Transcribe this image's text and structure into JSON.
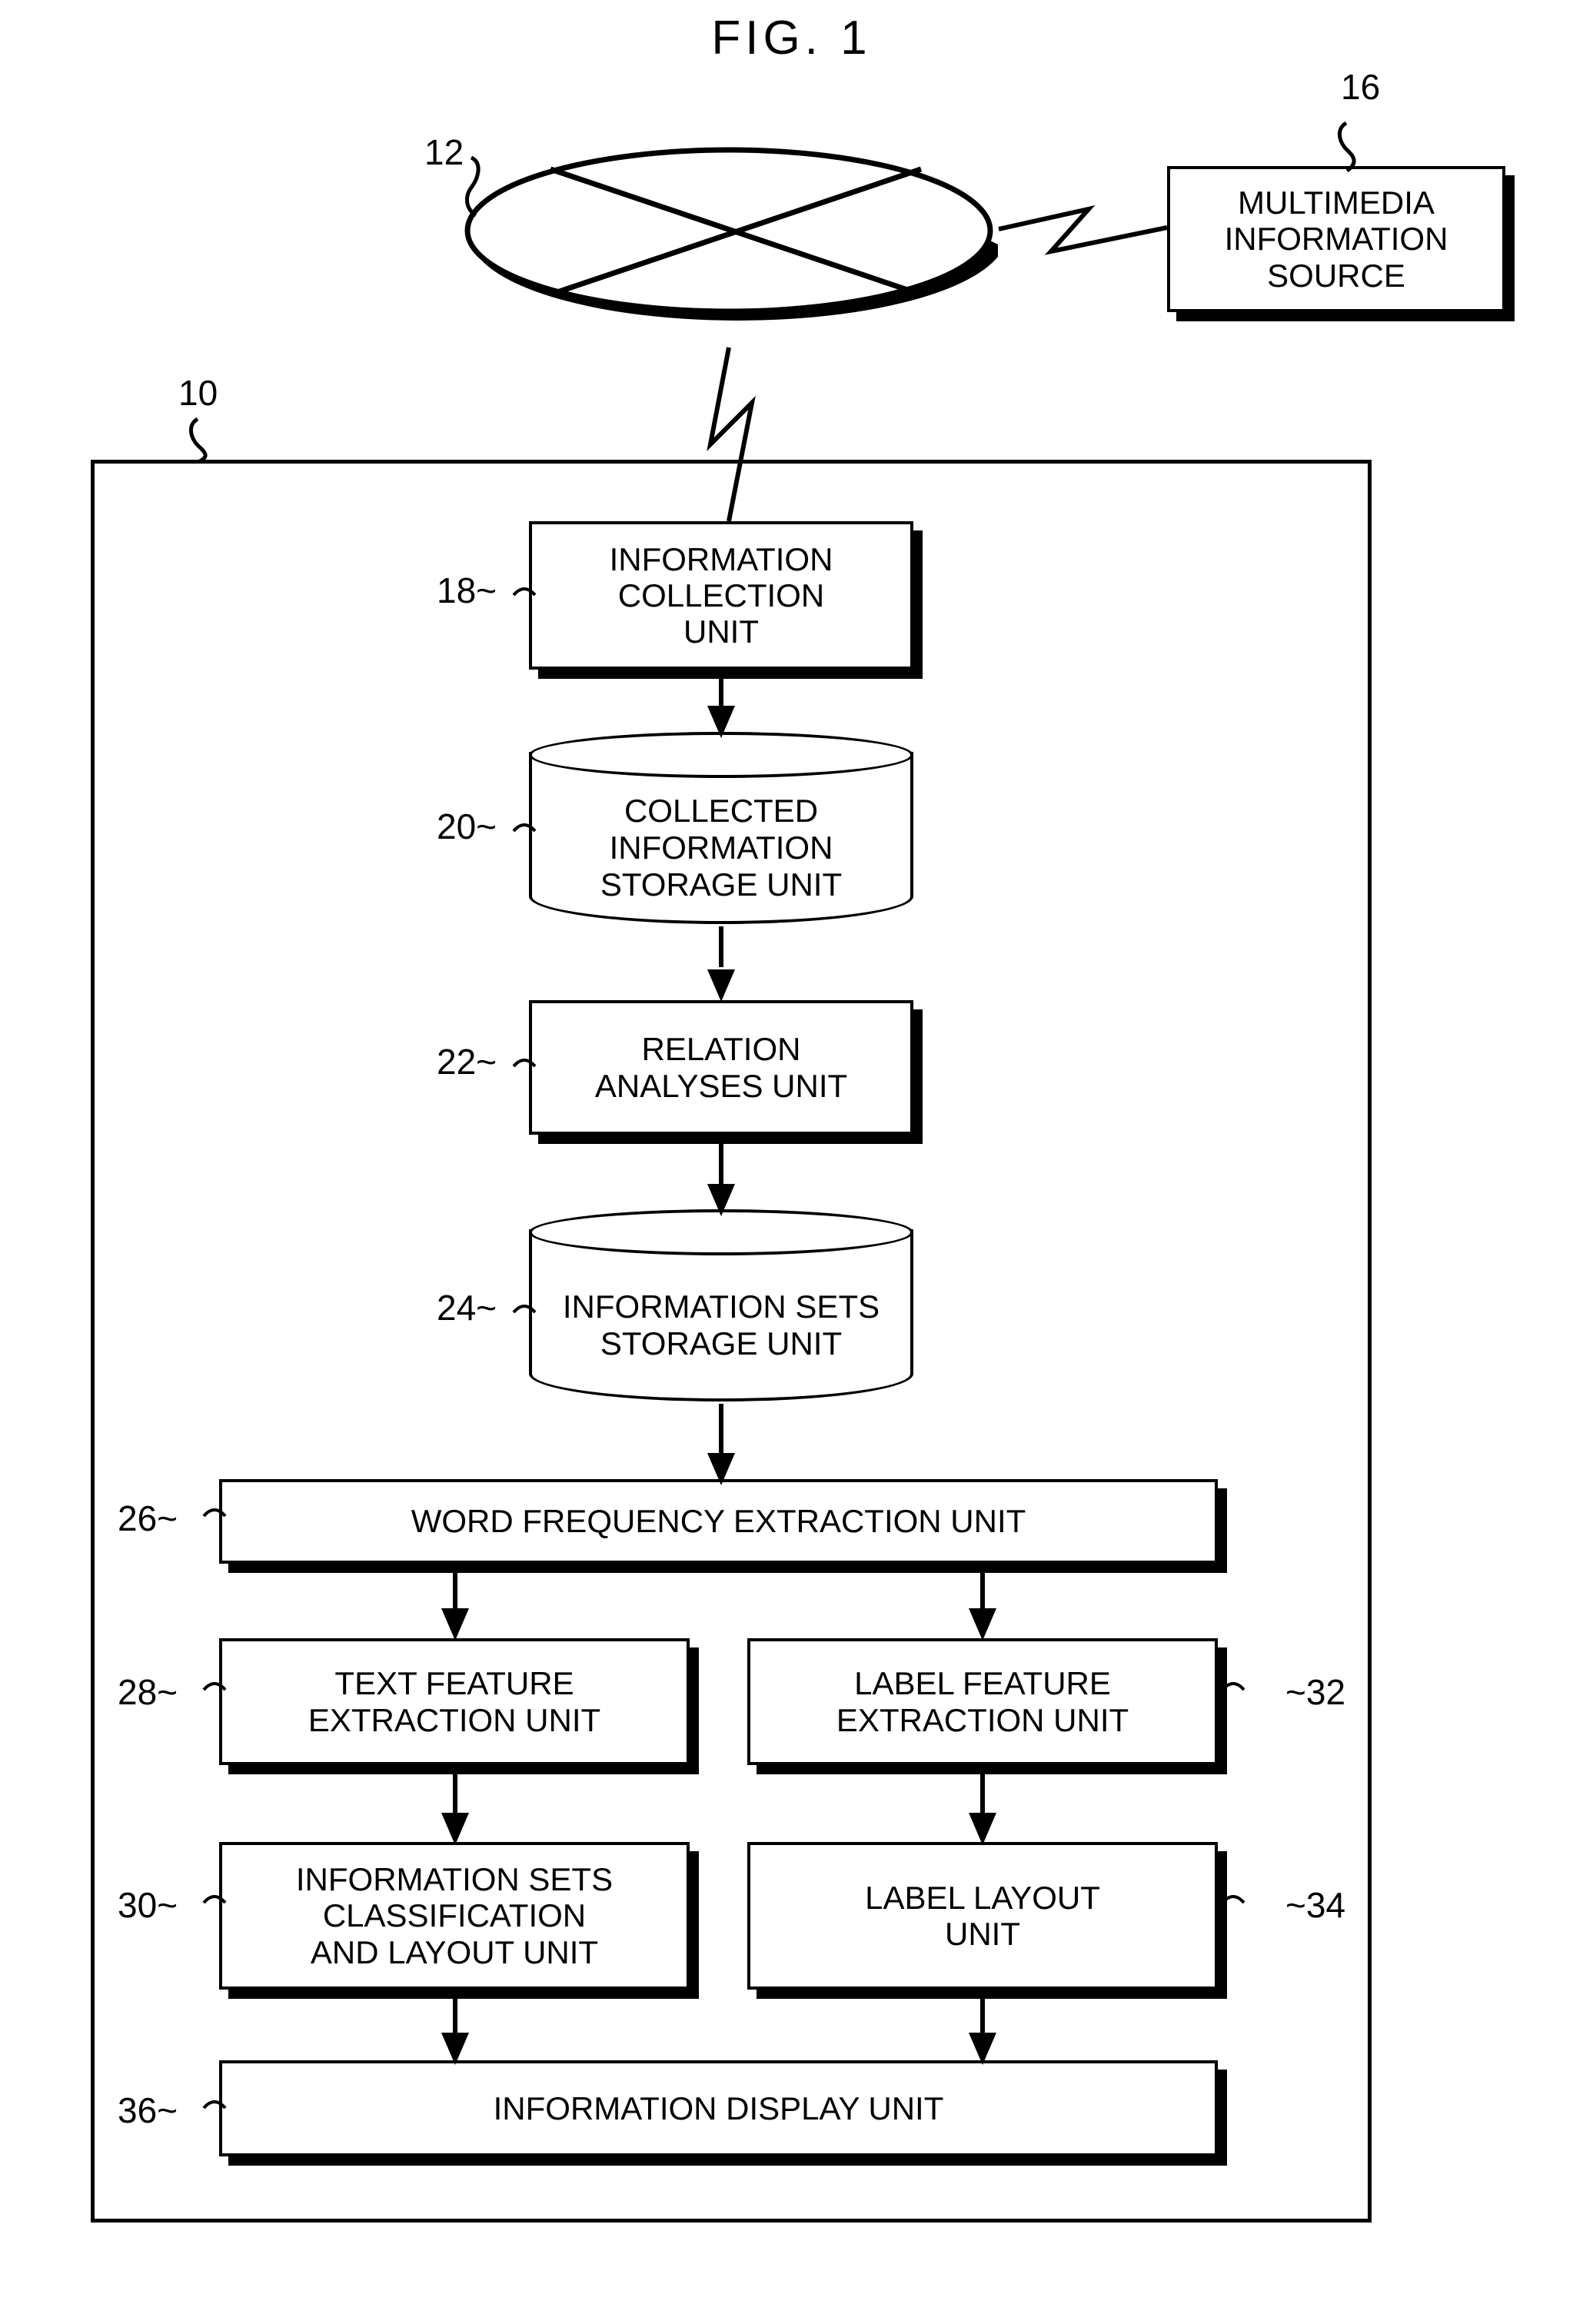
{
  "figure": {
    "title": "FIG. 1"
  },
  "reference_numerals": {
    "network": "12",
    "multimedia_source": "16",
    "system": "10",
    "information_collection": "18~",
    "collected_information_storage": "20~",
    "relation_analyses": "22~",
    "information_sets_storage": "24~",
    "word_frequency_extraction": "26~",
    "text_feature_extraction": "28~",
    "label_feature_extraction": "~32",
    "information_sets_classification": "30~",
    "label_layout": "~34",
    "information_display": "36~"
  },
  "nodes": {
    "multimedia_source": {
      "lines": [
        "MULTIMEDIA",
        "INFORMATION",
        "SOURCE"
      ],
      "shape": "box"
    },
    "network": {
      "lines": [],
      "shape": "ellipse-network"
    },
    "information_collection": {
      "lines": [
        "INFORMATION",
        "COLLECTION",
        "UNIT"
      ],
      "shape": "box"
    },
    "collected_information_storage": {
      "lines": [
        "COLLECTED",
        "INFORMATION",
        "STORAGE UNIT"
      ],
      "shape": "cylinder"
    },
    "relation_analyses": {
      "lines": [
        "RELATION",
        "ANALYSES UNIT"
      ],
      "shape": "box"
    },
    "information_sets_storage": {
      "lines": [
        "INFORMATION",
        "SETS",
        "STORAGE UNIT"
      ],
      "shape": "cylinder"
    },
    "word_frequency_extraction": {
      "lines": [
        "WORD FREQUENCY EXTRACTION UNIT"
      ],
      "shape": "box"
    },
    "text_feature_extraction": {
      "lines": [
        "TEXT FEATURE",
        "EXTRACTION UNIT"
      ],
      "shape": "box"
    },
    "label_feature_extraction": {
      "lines": [
        "LABEL FEATURE",
        "EXTRACTION UNIT"
      ],
      "shape": "box"
    },
    "information_sets_classification": {
      "lines": [
        "INFORMATION SETS",
        "CLASSIFICATION",
        "AND LAYOUT UNIT"
      ],
      "shape": "box"
    },
    "label_layout": {
      "lines": [
        "LABEL LAYOUT",
        "UNIT"
      ],
      "shape": "box"
    },
    "information_display": {
      "lines": [
        "INFORMATION DISPLAY UNIT"
      ],
      "shape": "box"
    }
  },
  "colors": {
    "stroke": "#000000",
    "fill": "#ffffff"
  }
}
